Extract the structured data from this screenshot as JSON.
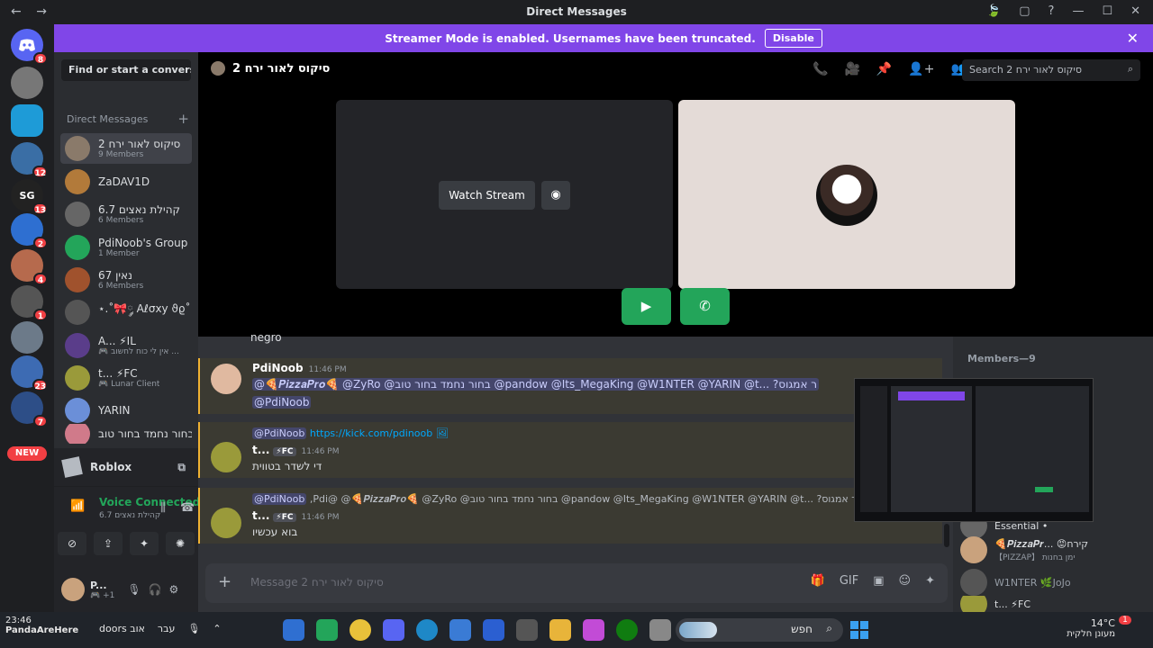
{
  "window": {
    "title": "Direct Messages",
    "nav_back": "←",
    "nav_forward": "→",
    "controls": [
      "🍃",
      "▢",
      "?",
      "—",
      "☐",
      "✕"
    ]
  },
  "streamer_bar": {
    "message": "Streamer Mode is enabled. Usernames have been truncated.",
    "disable_label": "Disable",
    "close_glyph": "✕"
  },
  "guilds": [
    {
      "label": "",
      "badge": "8",
      "color": "#5865f2"
    },
    {
      "label": "",
      "badge": "",
      "color": "#777"
    },
    {
      "label": "",
      "badge": "",
      "color": "#1e9bd7"
    },
    {
      "label": "",
      "badge": "12",
      "color": "#3a6ea5"
    },
    {
      "label": "SG",
      "badge": "13",
      "color": "#222"
    },
    {
      "label": "",
      "badge": "2",
      "color": "#2e6fd1"
    },
    {
      "label": "",
      "badge": "4",
      "color": "#b66a4d"
    },
    {
      "label": "",
      "badge": "1",
      "color": "#555"
    },
    {
      "label": "",
      "badge": "",
      "color": "#6c7a89"
    },
    {
      "label": "",
      "badge": "23",
      "color": "#3d6bb3"
    },
    {
      "label": "",
      "badge": "7",
      "color": "#2d4e87"
    }
  ],
  "guild_new_label": "NEW",
  "sidebar": {
    "find_placeholder": "Find or start a convers...",
    "section_title": "Direct Messages",
    "section_add": "+",
    "dms": [
      {
        "name": "סיקוס לאור ירח 2",
        "sub": "9 Members",
        "color": "#8a7a6a",
        "active": true
      },
      {
        "name": "ZaDAV1D",
        "sub": "",
        "color": "#b27a3a",
        "active": false
      },
      {
        "name": "קהילת נאצים 6.7",
        "sub": "6 Members",
        "color": "#666",
        "active": false
      },
      {
        "name": "PdiNoob's Group",
        "sub": "1 Member",
        "color": "#23a55a",
        "active": false
      },
      {
        "name": "נאין 67",
        "sub": "6 Members",
        "color": "#a0522d",
        "active": false
      },
      {
        "name": "⋆.˚🎀༘ Aℓσху ϑϱ˚⋆",
        "sub": "",
        "color": "#555",
        "active": false
      },
      {
        "name": "A... ⚡IL",
        "sub": "🎮 אין לי כוח לחשוב ...",
        "color": "#5a3d8a",
        "active": false
      },
      {
        "name": "t... ⚡FC",
        "sub": "🎮 Lunar Client",
        "color": "#9a9a3a",
        "active": false
      },
      {
        "name": "YARIN",
        "sub": "",
        "color": "#6b8fd8",
        "active": false
      },
      {
        "name": "בחור נחמד בחור טוב...",
        "sub": "",
        "color": "#d07a8a",
        "active": false
      }
    ],
    "activity_app": "Roblox",
    "voice_status": "Voice Connected",
    "voice_channel": "קהילת נאצים 6.7",
    "user_name": "P...",
    "user_sub": "🎮 +1"
  },
  "call": {
    "title": "סיקוס לאור ירח 2",
    "search_placeholder": "Search סיקוס לאור ירח 2",
    "watch_stream": "Watch Stream",
    "header_icons": [
      "📞",
      "🎥",
      "📌",
      "👤+",
      "👥"
    ]
  },
  "messages": {
    "partial_line": "negro",
    "items": [
      {
        "author": "PdiNoob",
        "time": "11:46 PM",
        "line1": "@🍕𝑷𝒊𝒛𝒛𝒂𝑷𝒓𝒐🍕 @ZyRo @בחור נחמד בחור טוב @pandow @Its_MegaKing @W1NTER @YARIN @t... ?ר אמגוס",
        "line2": "@PdiNoob"
      },
      {
        "reply_author": "@PdiNoob",
        "reply_text": "https://kick.com/pdinoob 🖼",
        "author": "t...",
        "tag": "⚡FC",
        "time": "11:46 PM",
        "line1": "די לשדר בטווית"
      },
      {
        "reply_author": "@PdiNoob",
        "reply_text": ",Pdi@ @🍕𝑷𝒊𝒛𝒛𝒂𝑷𝒓𝒐🍕 @ZyRo @בחור נחמד בחור טוב @pandow @Its_MegaKing @W1NTER @YARIN @t... ?ר אמגוס",
        "author": "t...",
        "tag": "⚡FC",
        "time": "11:46 PM",
        "line1": "בוא עכשיו"
      }
    ]
  },
  "composer": {
    "placeholder": "Message סיקוס לאור ירח 2",
    "plus": "+"
  },
  "members": {
    "header": "Members—9",
    "items": [
      {
        "name": "Essential •",
        "sub": "",
        "color": "#666"
      },
      {
        "name": "🍕𝑷𝒊𝒛𝒛𝒂𝑷𝒓... 😡קירח",
        "sub": "【PIZZAP】 ימן בחנות",
        "color": "#c9a27d"
      },
      {
        "name": "W1NTER 🌿JoJo",
        "sub": "",
        "color": "#555"
      },
      {
        "name": "t... ⚡FC",
        "sub": "",
        "color": "#9a9a3a"
      }
    ]
  },
  "taskbar": {
    "clock": "23:46",
    "label": "PandaAreHere",
    "lang": "עבר",
    "search_text": "חפש",
    "temperature": "14°C",
    "weather": "מעונן חלקית",
    "notif_badge": "1",
    "doors": "doors אוב"
  }
}
